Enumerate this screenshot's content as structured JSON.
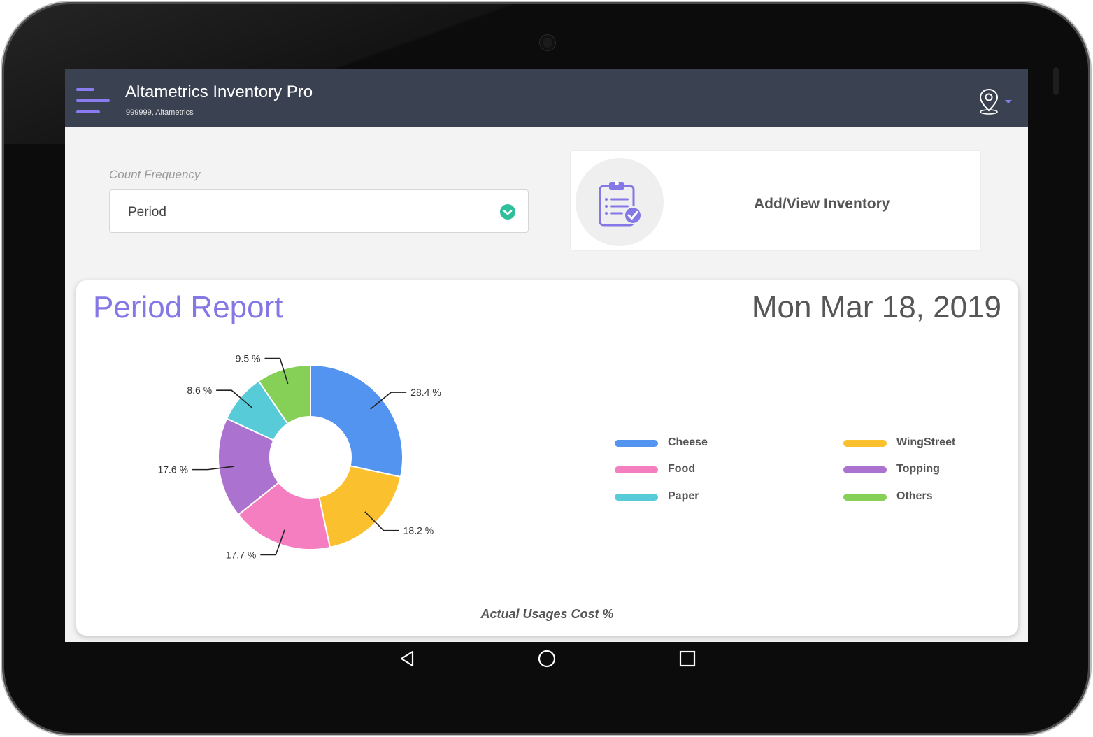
{
  "app": {
    "title": "Altametrics Inventory Pro",
    "subtitle": "999999, Altametrics"
  },
  "count_frequency": {
    "label": "Count Frequency",
    "value": "Period"
  },
  "inventory_card": {
    "label": "Add/View Inventory"
  },
  "report": {
    "title": "Period Report",
    "date": "Mon Mar 18, 2019",
    "caption": "Actual Usages Cost %"
  },
  "colors": {
    "appbar": "#3a4150",
    "accent": "#8477e6",
    "check": "#2fbf9a"
  },
  "chart_data": {
    "type": "pie",
    "donut": true,
    "categories": [
      "Cheese",
      "WingStreet",
      "Food",
      "Topping",
      "Paper",
      "Others"
    ],
    "values": [
      28.4,
      18.2,
      17.7,
      17.6,
      8.6,
      9.5
    ],
    "labels": [
      "28.4 %",
      "18.2 %",
      "17.7 %",
      "17.6 %",
      "8.6 %",
      "9.5 %"
    ],
    "colors": [
      "#5394f0",
      "#fbc02d",
      "#f47ec0",
      "#ac72cf",
      "#58cbd9",
      "#86d058"
    ],
    "legend": {
      "placement": "right",
      "items": [
        {
          "label": "Cheese",
          "color": "#5394f0"
        },
        {
          "label": "WingStreet",
          "color": "#fbc02d"
        },
        {
          "label": "Food",
          "color": "#f47ec0"
        },
        {
          "label": "Topping",
          "color": "#ac72cf"
        },
        {
          "label": "Paper",
          "color": "#58cbd9"
        },
        {
          "label": "Others",
          "color": "#86d058"
        }
      ]
    },
    "title": "",
    "xlabel": "Actual Usages Cost %"
  }
}
